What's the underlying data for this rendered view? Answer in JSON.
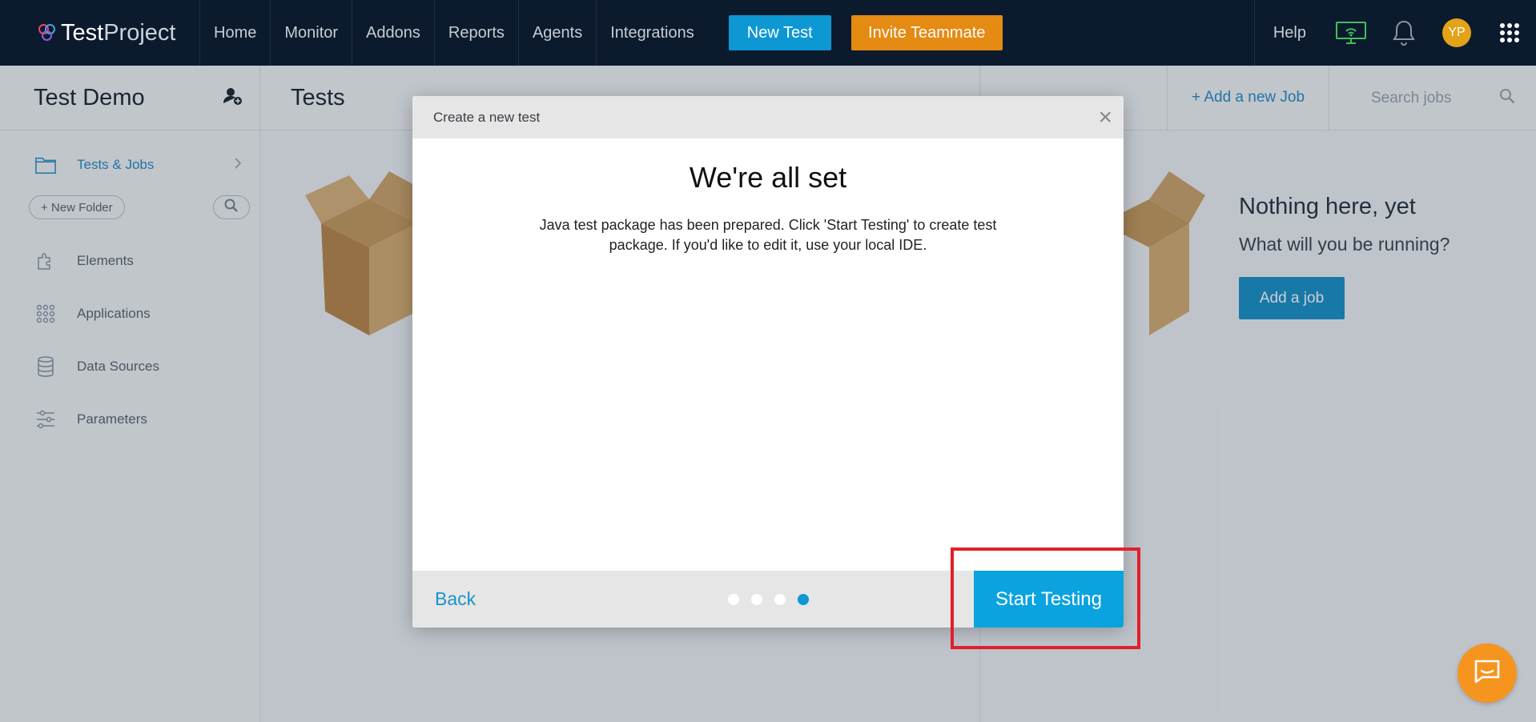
{
  "brand": {
    "part1": "Test",
    "part2": "Project"
  },
  "nav": {
    "items": [
      "Home",
      "Monitor",
      "Addons",
      "Reports",
      "Agents",
      "Integrations"
    ],
    "new_test": "New Test",
    "invite": "Invite Teammate",
    "help": "Help",
    "avatar_initials": "YP"
  },
  "sidebar": {
    "project_title": "Test Demo",
    "tests_jobs": "Tests & Jobs",
    "new_folder": "+ New Folder",
    "items": [
      "Elements",
      "Applications",
      "Data Sources",
      "Parameters"
    ]
  },
  "tests_panel": {
    "title": "Tests"
  },
  "jobs_panel": {
    "add_job_link": "+  Add a new Job",
    "search_placeholder": "Search jobs",
    "empty_title": "Nothing here, yet",
    "empty_sub": "What will you be running?",
    "add_job_button": "Add a job"
  },
  "modal": {
    "header": "Create a new test",
    "title": "We're all set",
    "message": "Java test package has been prepared. Click 'Start Testing' to create test package. If you'd like to edit it, use your local IDE.",
    "back": "Back",
    "start": "Start Testing",
    "step_count": 4,
    "active_step": 4
  }
}
